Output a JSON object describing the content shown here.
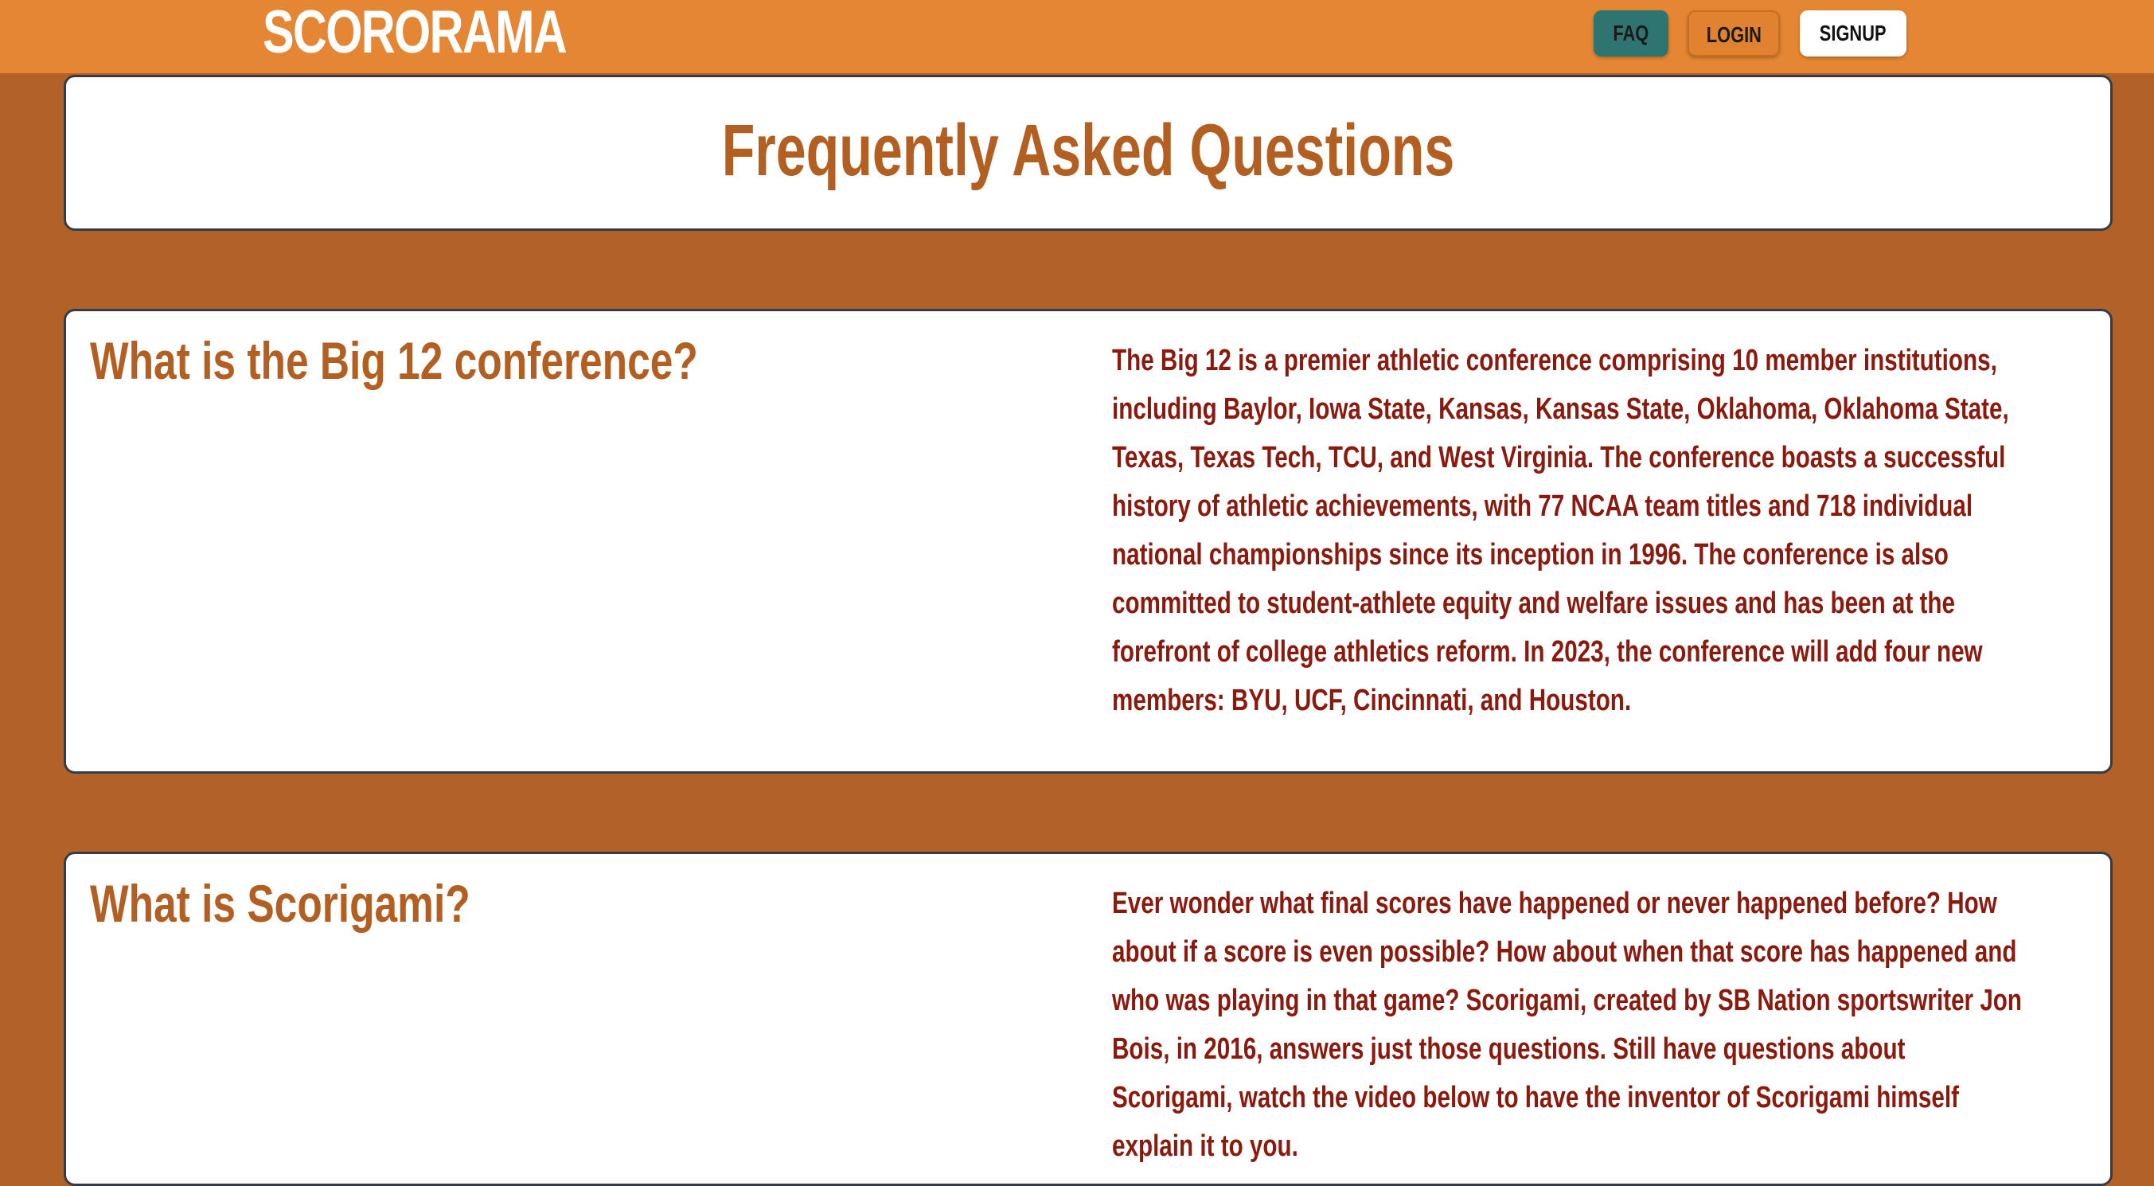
{
  "navbar": {
    "brand": "SCORORAMA",
    "faq_label": "FAQ",
    "login_label": "LOGIN",
    "signup_label": "SIGNUP",
    "bg_color": "#e48633",
    "active_color": "#2e7470"
  },
  "page": {
    "title": "Frequently Asked Questions",
    "bg_color": "#b26128"
  },
  "faqs": [
    {
      "question": "What is the Big 12 conference?",
      "answer": "The Big 12 is a premier athletic conference comprising 10 member institutions, including Baylor, Iowa State, Kansas, Kansas State, Oklahoma, Oklahoma State, Texas, Texas Tech, TCU, and West Virginia. The conference boasts a successful history of athletic achievements, with 77 NCAA team titles and 718 individual national championships since its inception in 1996. The conference is also committed to student-athlete equity and welfare issues and has been at the forefront of college athletics reform. In 2023, the conference will add four new members: BYU, UCF, Cincinnati, and Houston."
    },
    {
      "question": "What is Scorigami?",
      "answer": "Ever wonder what final scores have happened or never happened before? How about if a score is even possible? How about when that score has happened and who was playing in that game? Scorigami, created by SB Nation sportswriter Jon Bois, in 2016, answers just those questions. Still have questions about Scorigami, watch the video below to have the inventor of Scorigami himself explain it to you."
    }
  ]
}
